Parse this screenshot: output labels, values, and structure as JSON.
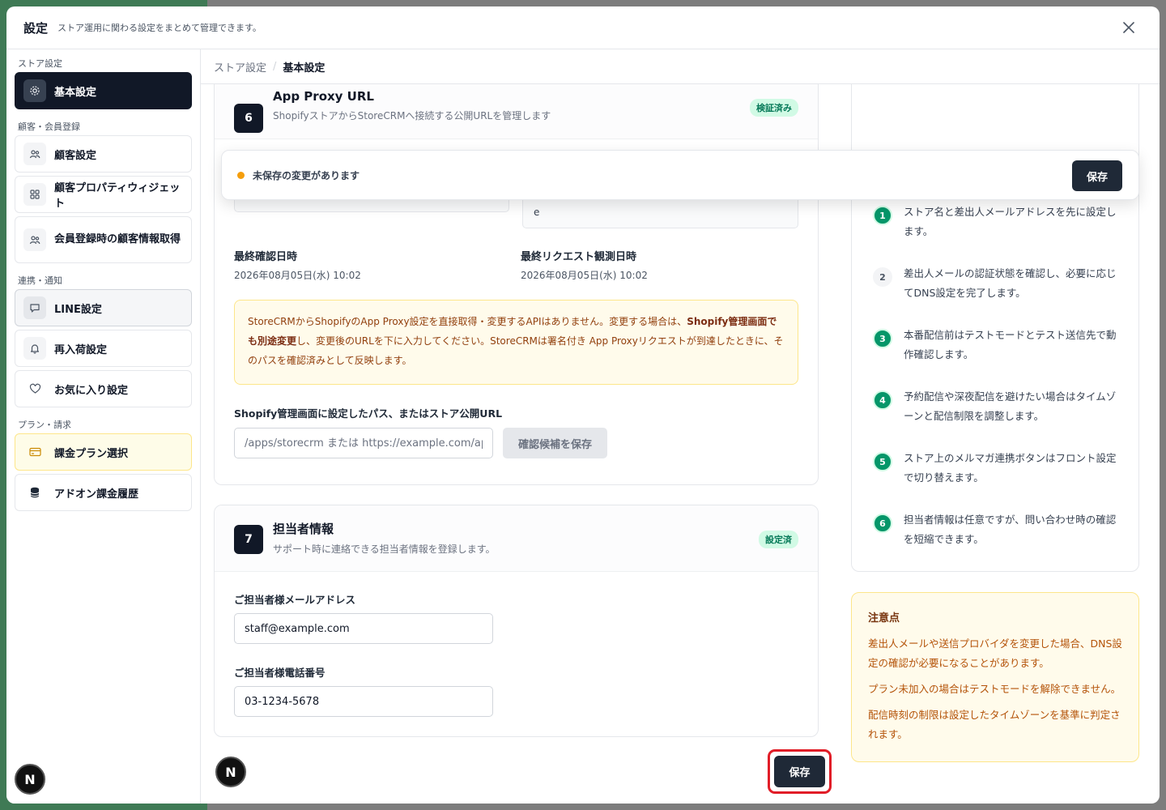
{
  "modal": {
    "title": "設定",
    "subtitle": "ストア運用に関わる設定をまとめて管理できます。"
  },
  "sidebar": {
    "sections": [
      {
        "label": "ストア設定"
      },
      {
        "label": "顧客・会員登録"
      },
      {
        "label": "連携・通知"
      },
      {
        "label": "プラン・請求"
      }
    ],
    "items": [
      {
        "label": "基本設定",
        "icon": "gear-icon"
      },
      {
        "label": "顧客設定",
        "icon": "users-icon"
      },
      {
        "label": "顧客プロパティウィジェット",
        "icon": "grid-icon"
      },
      {
        "label": "会員登録時の顧客情報取得",
        "icon": "users-icon"
      },
      {
        "label": "LINE設定",
        "icon": "chat-icon"
      },
      {
        "label": "再入荷設定",
        "icon": "bell-icon"
      },
      {
        "label": "お気に入り設定",
        "icon": "heart-icon"
      },
      {
        "label": "課金プラン選択",
        "icon": "credit-card-icon"
      },
      {
        "label": "アドオン課金履歴",
        "icon": "database-icon"
      }
    ]
  },
  "breadcrumb": {
    "parent": "ストア設定",
    "separator": "/",
    "current": "基本設定"
  },
  "proxy_card": {
    "step": "6",
    "title": "App Proxy URL",
    "desc": "ShopifyストアからStoreCRMへ接続する公開URLを管理します",
    "badge": "検証済み",
    "partial_value": "e",
    "last_checked_label": "最終確認日時",
    "last_checked_value": "2026年08月05日(水) 10:02",
    "last_request_label": "最終リクエスト観測日時",
    "last_request_value": "2026年08月05日(水) 10:02",
    "notice_pre": "StoreCRMからShopifyのApp Proxy設定を直接取得・変更するAPIはありません。変更する場合は、",
    "notice_bold": "Shopify管理画面でも別途変更",
    "notice_post": "し、変更後のURLを下に入力してください。StoreCRMは署名付き App Proxyリクエストが到達したときに、そのパスを確認済みとして反映します。",
    "path_label": "Shopify管理画面に設定したパス、またはストア公開URL",
    "path_placeholder": "/apps/storecrm または https://example.com/apps/storecrm",
    "save_candidate_label": "確認候補を保存"
  },
  "unsaved": {
    "text": "未保存の変更があります",
    "save_label": "保存"
  },
  "contact_card": {
    "step": "7",
    "title": "担当者情報",
    "desc": "サポート時に連絡できる担当者情報を登録します。",
    "badge": "設定済",
    "email_label": "ご担当者様メールアドレス",
    "email_value": "staff@example.com",
    "phone_label": "ご担当者様電話番号",
    "phone_value": "03-1234-5678"
  },
  "tips": [
    {
      "num": "1",
      "text": "ストア名と差出人メールアドレスを先に設定します。"
    },
    {
      "num": "2",
      "text": "差出人メールの認証状態を確認し、必要に応じてDNS設定を完了します。"
    },
    {
      "num": "3",
      "text": "本番配信前はテストモードとテスト送信先で動作確認します。"
    },
    {
      "num": "4",
      "text": "予約配信や深夜配信を避けたい場合はタイムゾーンと配信制限を調整します。"
    },
    {
      "num": "5",
      "text": "ストア上のメルマガ連携ボタンはフロント設定で切り替えます。"
    },
    {
      "num": "6",
      "text": "担当者情報は任意ですが、問い合わせ時の確認を短縮できます。"
    }
  ],
  "caution": {
    "title": "注意点",
    "items": [
      "差出人メールや送信プロバイダを変更した場合、DNS設定の確認が必要になることがあります。",
      "プラン未加入の場合はテストモードを解除できません。",
      "配信時刻の制限は設定したタイムゾーンを基準に判定されます。"
    ]
  },
  "bottom": {
    "save_label": "保存",
    "avatar_letter": "N"
  }
}
